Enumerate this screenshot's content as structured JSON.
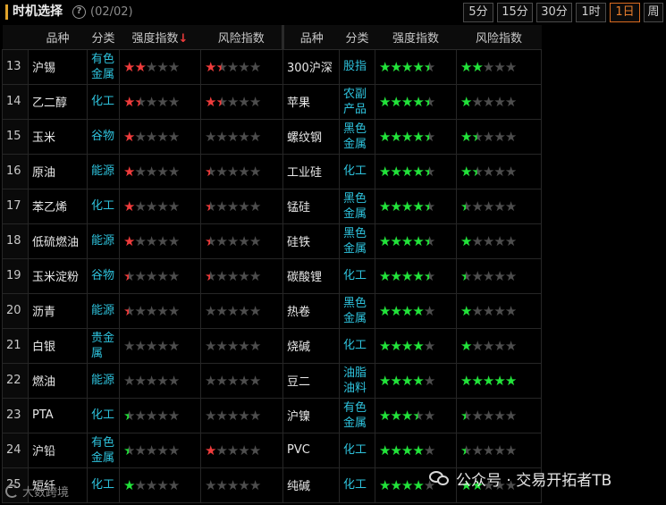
{
  "header": {
    "title": "时机选择",
    "page_count": "(02/02)",
    "periods": [
      {
        "label": "5分",
        "active": false
      },
      {
        "label": "15分",
        "active": false
      },
      {
        "label": "30分",
        "active": false
      },
      {
        "label": "1时",
        "active": false
      },
      {
        "label": "1日",
        "active": true
      },
      {
        "label": "周",
        "active": false
      }
    ]
  },
  "table": {
    "columns": [
      "品种",
      "分类",
      "强度指数",
      "风险指数",
      "品种",
      "分类",
      "强度指数",
      "风险指数"
    ],
    "sort_column": 2,
    "sort_arrow": "↓",
    "rows": [
      {
        "idx": "13",
        "left": {
          "name": "沪锡",
          "cat": [
            "有色",
            "金属"
          ],
          "strength": [
            2,
            "red"
          ],
          "risk": [
            1.5,
            "red"
          ]
        },
        "right": {
          "name": "300沪深",
          "cat": [
            "股指"
          ],
          "strength": [
            4.5,
            "green"
          ],
          "risk": [
            2,
            "green"
          ]
        }
      },
      {
        "idx": "14",
        "left": {
          "name": "乙二醇",
          "cat": [
            "化工"
          ],
          "strength": [
            1.5,
            "red"
          ],
          "risk": [
            1.5,
            "red"
          ]
        },
        "right": {
          "name": "苹果",
          "cat": [
            "农副",
            "产品"
          ],
          "strength": [
            4.5,
            "green"
          ],
          "risk": [
            1,
            "green"
          ]
        }
      },
      {
        "idx": "15",
        "left": {
          "name": "玉米",
          "cat": [
            "谷物"
          ],
          "strength": [
            1,
            "red"
          ],
          "risk": [
            0,
            "red"
          ]
        },
        "right": {
          "name": "螺纹钢",
          "cat": [
            "黑色",
            "金属"
          ],
          "strength": [
            4.5,
            "green"
          ],
          "risk": [
            1.5,
            "green"
          ]
        }
      },
      {
        "idx": "16",
        "left": {
          "name": "原油",
          "cat": [
            "能源"
          ],
          "strength": [
            1,
            "red"
          ],
          "risk": [
            0.5,
            "red"
          ]
        },
        "right": {
          "name": "工业硅",
          "cat": [
            "化工"
          ],
          "strength": [
            4.5,
            "green"
          ],
          "risk": [
            1.5,
            "green"
          ]
        }
      },
      {
        "idx": "17",
        "left": {
          "name": "苯乙烯",
          "cat": [
            "化工"
          ],
          "strength": [
            1,
            "red"
          ],
          "risk": [
            0.5,
            "red"
          ]
        },
        "right": {
          "name": "锰硅",
          "cat": [
            "黑色",
            "金属"
          ],
          "strength": [
            4.5,
            "green"
          ],
          "risk": [
            0.5,
            "green"
          ]
        }
      },
      {
        "idx": "18",
        "left": {
          "name": "低硫燃油",
          "cat": [
            "能源"
          ],
          "strength": [
            1,
            "red"
          ],
          "risk": [
            0.5,
            "red"
          ]
        },
        "right": {
          "name": "硅铁",
          "cat": [
            "黑色",
            "金属"
          ],
          "strength": [
            4.5,
            "green"
          ],
          "risk": [
            1,
            "green"
          ]
        }
      },
      {
        "idx": "19",
        "left": {
          "name": "玉米淀粉",
          "cat": [
            "谷物"
          ],
          "strength": [
            0.5,
            "red"
          ],
          "risk": [
            0.5,
            "red"
          ]
        },
        "right": {
          "name": "碳酸锂",
          "cat": [
            "化工"
          ],
          "strength": [
            4.5,
            "green"
          ],
          "risk": [
            0.5,
            "green"
          ]
        }
      },
      {
        "idx": "20",
        "left": {
          "name": "沥青",
          "cat": [
            "能源"
          ],
          "strength": [
            0.5,
            "red"
          ],
          "risk": [
            0,
            "red"
          ]
        },
        "right": {
          "name": "热卷",
          "cat": [
            "黑色",
            "金属"
          ],
          "strength": [
            4,
            "green"
          ],
          "risk": [
            1,
            "green"
          ]
        }
      },
      {
        "idx": "21",
        "left": {
          "name": "白银",
          "cat": [
            "贵金",
            "属"
          ],
          "strength": [
            0,
            "red"
          ],
          "risk": [
            0,
            "red"
          ]
        },
        "right": {
          "name": "烧碱",
          "cat": [
            "化工"
          ],
          "strength": [
            4,
            "green"
          ],
          "risk": [
            1,
            "green"
          ]
        }
      },
      {
        "idx": "22",
        "left": {
          "name": "燃油",
          "cat": [
            "能源"
          ],
          "strength": [
            0,
            "red"
          ],
          "risk": [
            0,
            "red"
          ]
        },
        "right": {
          "name": "豆二",
          "cat": [
            "油脂",
            "油料"
          ],
          "strength": [
            4,
            "green"
          ],
          "risk": [
            5,
            "green"
          ]
        }
      },
      {
        "idx": "23",
        "left": {
          "name": "PTA",
          "cat": [
            "化工"
          ],
          "strength": [
            0.5,
            "green"
          ],
          "risk": [
            0,
            "red"
          ]
        },
        "right": {
          "name": "沪镍",
          "cat": [
            "有色",
            "金属"
          ],
          "strength": [
            3.5,
            "green"
          ],
          "risk": [
            0.5,
            "green"
          ]
        }
      },
      {
        "idx": "24",
        "left": {
          "name": "沪铅",
          "cat": [
            "有色",
            "金属"
          ],
          "strength": [
            0.5,
            "green"
          ],
          "risk": [
            1,
            "red"
          ]
        },
        "right": {
          "name": "PVC",
          "cat": [
            "化工"
          ],
          "strength": [
            4,
            "green"
          ],
          "risk": [
            0.5,
            "green"
          ]
        }
      },
      {
        "idx": "25",
        "left": {
          "name": "短纤",
          "cat": [
            "化工"
          ],
          "strength": [
            1,
            "green"
          ],
          "risk": [
            0,
            "red"
          ]
        },
        "right": {
          "name": "纯碱",
          "cat": [
            "化工"
          ],
          "strength": [
            4,
            "green"
          ],
          "risk": [
            2,
            "green"
          ]
        }
      }
    ]
  },
  "watermark": {
    "text": "公众号 · 交易开拓者TB"
  },
  "footer_watermark": {
    "text": "大数跨境"
  }
}
